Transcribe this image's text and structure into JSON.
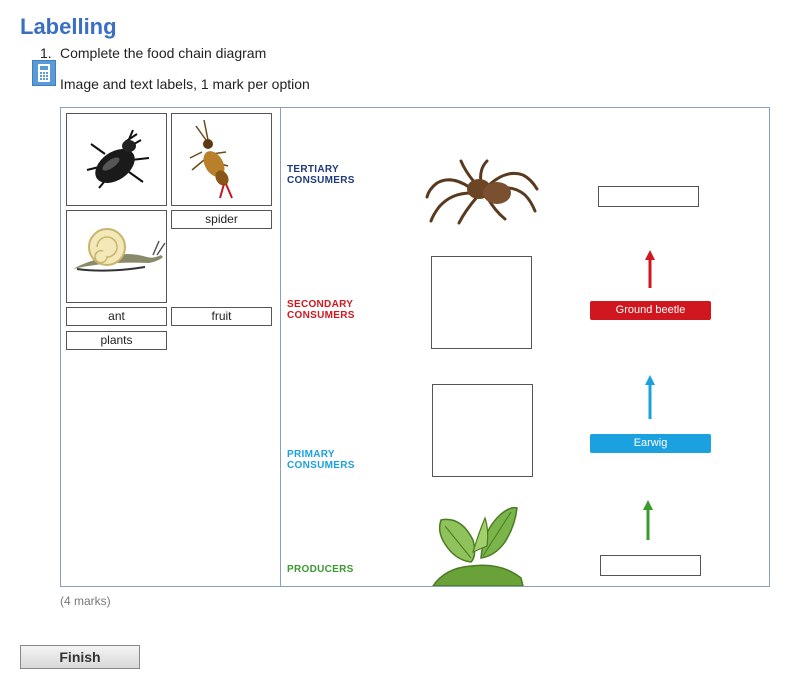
{
  "title": "Labelling",
  "question": {
    "number": "1.",
    "text": "Complete the food chain diagram",
    "subtitle": "Image and text labels, 1 mark per option"
  },
  "icons": {
    "calculator": "calculator-icon",
    "beetle": "beetle-image",
    "earwig": "earwig-image",
    "snail": "snail-image",
    "spider": "spider-image",
    "leaves": "leaves-image"
  },
  "source_labels": {
    "spider": "spider",
    "ant": "ant",
    "fruit": "fruit",
    "plants": "plants"
  },
  "levels": {
    "tertiary": {
      "line1": "TERTIARY",
      "line2": "CONSUMERS",
      "color": "#1f3a7a"
    },
    "secondary": {
      "line1": "SECONDARY",
      "line2": "CONSUMERS",
      "color": "#d0161e"
    },
    "primary": {
      "line1": "PRIMARY",
      "line2": "CONSUMERS",
      "color": "#1ba0e0"
    },
    "producers": {
      "line1": "PRODUCERS",
      "color": "#3a9a2e"
    }
  },
  "chain_labels": {
    "ground_beetle": "Ground beetle",
    "earwig": "Earwig"
  },
  "colors": {
    "red": "#d0161e",
    "blue": "#1ba0e0",
    "green": "#3a9a2e"
  },
  "marks": "(4 marks)",
  "finish_label": "Finish"
}
